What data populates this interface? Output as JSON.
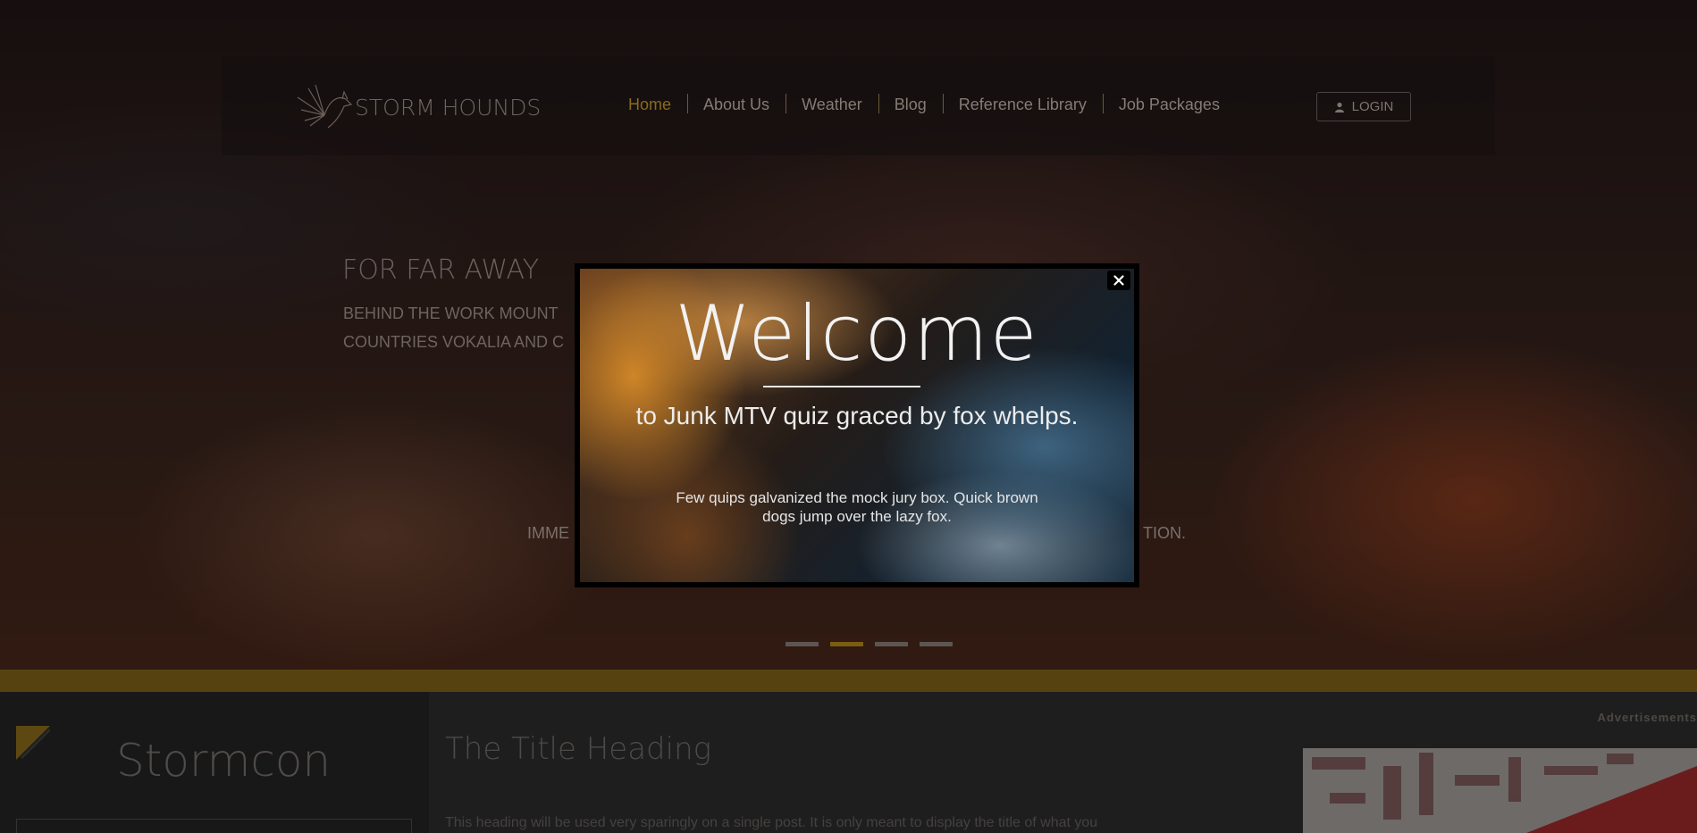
{
  "brand": {
    "name": "STORM HOUNDS",
    "logo_icon": "hound-logo-icon"
  },
  "nav": {
    "items": [
      {
        "label": "Home",
        "active": true
      },
      {
        "label": "About Us",
        "active": false
      },
      {
        "label": "Weather",
        "active": false
      },
      {
        "label": "Blog",
        "active": false
      },
      {
        "label": "Reference Library",
        "active": false
      },
      {
        "label": "Job Packages",
        "active": false
      }
    ],
    "login_label": "LOGIN"
  },
  "hero": {
    "heading": "FOR FAR AWAY",
    "sub_line_1": "BEHIND THE WORK MOUNT",
    "sub_line_2": "COUNTRIES VOKALIA AND C",
    "tag_left": "IMME",
    "tag_right": "TION.",
    "slide_count": 4,
    "active_slide": 2
  },
  "modal": {
    "close_symbol": "×",
    "title": "Welcome",
    "subtitle": "to Junk MTV quiz graced by fox whelps.",
    "body_line_1": "Few quips galvanized the mock jury box. Quick brown",
    "body_line_2": "dogs jump over the lazy fox."
  },
  "sidebar": {
    "title": "Stormcon"
  },
  "main": {
    "ads_label": "Advertisements",
    "title_heading": "The Title Heading",
    "text": "This heading will be used very sparingly on a single post. It is only meant to display the title of what you"
  },
  "colors": {
    "accent": "#8a6a1e",
    "gold_bar": "#564210"
  }
}
